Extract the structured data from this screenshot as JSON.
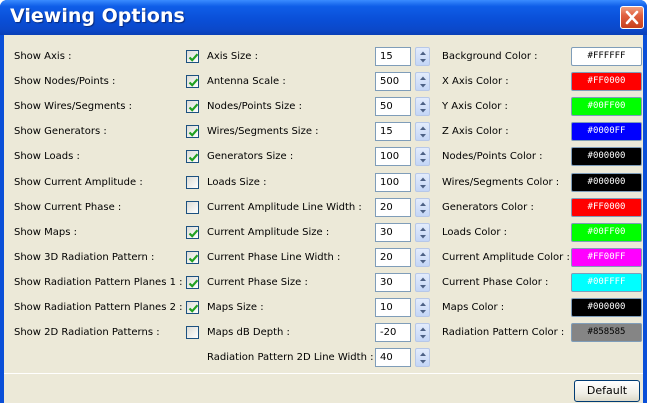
{
  "window": {
    "title": "Viewing Options"
  },
  "show_options": [
    {
      "label": "Show Axis :",
      "checked": true
    },
    {
      "label": "Show Nodes/Points :",
      "checked": true
    },
    {
      "label": "Show Wires/Segments :",
      "checked": true
    },
    {
      "label": "Show Generators :",
      "checked": true
    },
    {
      "label": "Show Loads :",
      "checked": true
    },
    {
      "label": "Show Current Amplitude :",
      "checked": false
    },
    {
      "label": "Show Current Phase :",
      "checked": false
    },
    {
      "label": "Show Maps :",
      "checked": true
    },
    {
      "label": "Show 3D Radiation Pattern :",
      "checked": true
    },
    {
      "label": "Show Radiation Pattern Planes 1 :",
      "checked": true
    },
    {
      "label": "Show Radiation Pattern Planes 2 :",
      "checked": true
    },
    {
      "label": "Show 2D Radiation Patterns :",
      "checked": false
    }
  ],
  "size_options": [
    {
      "label": "Axis Size :",
      "value": "15"
    },
    {
      "label": "Antenna Scale :",
      "value": "500"
    },
    {
      "label": "Nodes/Points Size :",
      "value": "50"
    },
    {
      "label": "Wires/Segments Size :",
      "value": "15"
    },
    {
      "label": "Generators Size :",
      "value": "100"
    },
    {
      "label": "Loads Size :",
      "value": "100"
    },
    {
      "label": "Current Amplitude Line Width :",
      "value": "20"
    },
    {
      "label": "Current Amplitude Size :",
      "value": "30"
    },
    {
      "label": "Current Phase Line Width :",
      "value": "20"
    },
    {
      "label": "Current Phase Size :",
      "value": "30"
    },
    {
      "label": "Maps Size :",
      "value": "10"
    },
    {
      "label": "Maps dB Depth :",
      "value": "-20"
    },
    {
      "label": "Radiation Pattern 2D Line Width :",
      "value": "40"
    }
  ],
  "color_options": [
    {
      "label": "Background Color :",
      "value": "#FFFFFF",
      "bg": "#FFFFFF",
      "fg": "#000000"
    },
    {
      "label": "X Axis Color :",
      "value": "#FF0000",
      "bg": "#FF0000",
      "fg": "#FFFFFF"
    },
    {
      "label": "Y Axis Color :",
      "value": "#00FF00",
      "bg": "#00FF00",
      "fg": "#FFFFFF"
    },
    {
      "label": "Z Axis Color :",
      "value": "#0000FF",
      "bg": "#0000FF",
      "fg": "#FFFFFF"
    },
    {
      "label": "Nodes/Points Color :",
      "value": "#000000",
      "bg": "#000000",
      "fg": "#FFFFFF"
    },
    {
      "label": "Wires/Segments Color :",
      "value": "#000000",
      "bg": "#000000",
      "fg": "#FFFFFF"
    },
    {
      "label": "Generators Color :",
      "value": "#FF0000",
      "bg": "#FF0000",
      "fg": "#FFFFFF"
    },
    {
      "label": "Loads Color :",
      "value": "#00FF00",
      "bg": "#00FF00",
      "fg": "#FFFFFF"
    },
    {
      "label": "Current Amplitude Color :",
      "value": "#FF00FF",
      "bg": "#FF00FF",
      "fg": "#FFFFFF"
    },
    {
      "label": "Current Phase Color :",
      "value": "#00FFFF",
      "bg": "#00FFFF",
      "fg": "#FFFFFF"
    },
    {
      "label": "Maps Color :",
      "value": "#000000",
      "bg": "#000000",
      "fg": "#FFFFFF"
    },
    {
      "label": "Radiation Pattern Color :",
      "value": "#858585",
      "bg": "#858585",
      "fg": "#000000"
    }
  ],
  "buttons": {
    "default_label": "Default"
  },
  "icons": {
    "close": "close-icon",
    "check": "checkmark-icon",
    "spin_up": "spin-up-icon",
    "spin_down": "spin-down-icon"
  }
}
